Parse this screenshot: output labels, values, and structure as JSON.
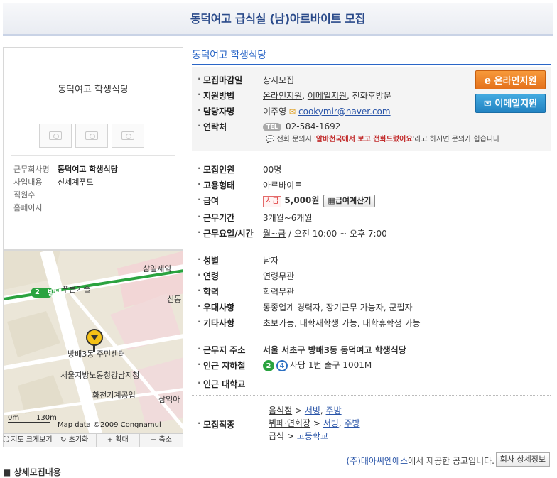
{
  "page": {
    "title": "동덕여고 급식실 (남)아르바이트 모집"
  },
  "company": {
    "name": "동덕여고 학생식당",
    "info": [
      {
        "key": "근무회사명",
        "value": "동덕여고 학생식당"
      },
      {
        "key": "사업내용",
        "value": "신세계푸드"
      },
      {
        "key": "직원수",
        "value": ""
      },
      {
        "key": "홈페이지",
        "value": ""
      }
    ]
  },
  "map": {
    "labels": {
      "samil": "삼일제약",
      "purun": "푸른기술",
      "bangbae": "방배",
      "sindong": "신동",
      "center": "방배3동 주민센터",
      "court": "서울지방노동청강남지청",
      "hwacheon": "화천기계공업",
      "samik": "삼익아",
      "scale_0": "0m",
      "scale_130": "130m",
      "copyright": "Map data ©2009 Congnamul",
      "station_num": "2"
    },
    "controls": [
      "지도 크게보기",
      "초기화",
      "확대",
      "축소"
    ]
  },
  "apply": {
    "rows": [
      {
        "key": "모집마감일",
        "value": "상시모집"
      },
      {
        "key": "지원방법",
        "online": "온라인지원",
        "email": "이메일지원",
        "phone": ", 전화후방문"
      },
      {
        "key": "담당자명",
        "name": "이주영",
        "email": "cookymir@naver.com"
      },
      {
        "key": "연락처",
        "tel_badge": "TEL",
        "phone": "02-584-1692"
      }
    ],
    "note_pre": "전화 문의시 '",
    "note_quote": "알바천국에서 보고 전화드렸어요",
    "note_post": "'라고 하시면 문의가 쉽습니다",
    "online_button": "온라인지원",
    "email_button": "이메일지원"
  },
  "conditions": {
    "rows": [
      {
        "key": "모집인원",
        "value": "00명"
      },
      {
        "key": "고용형태",
        "value": "아르바이트"
      },
      {
        "key": "급여",
        "badge": "시급",
        "value": "5,000원",
        "calc": "급여계산기"
      },
      {
        "key": "근무기간",
        "value": "3개월~6개월"
      },
      {
        "key": "근무요일/시간",
        "days": "월~금",
        "time": " / 오전 10:00 ~ 오후 7:00"
      }
    ]
  },
  "requirements": {
    "rows": [
      {
        "key": "성별",
        "value": "남자"
      },
      {
        "key": "연령",
        "value": "연령무관"
      },
      {
        "key": "학력",
        "value": "학력무관"
      },
      {
        "key": "우대사항",
        "value": "동종업계 경력자, 장기근무 가능자, 군필자"
      },
      {
        "key": "기타사항",
        "items": [
          "초보가능",
          "대학재학생 가능",
          "대학휴학생 가능"
        ]
      }
    ]
  },
  "location": {
    "rows": [
      {
        "key": "근무지 주소",
        "city": "서울",
        "gu": "서초구",
        "rest": "방배3동 동덕여고 학생식당"
      },
      {
        "key": "인근 지하철",
        "line2": "2",
        "line4": "4",
        "station": "사당",
        "exit": "1번 출구 1001M"
      },
      {
        "key": "인근 대학교",
        "value": ""
      }
    ]
  },
  "jobs": {
    "key": "모집직종",
    "lines": [
      {
        "a": "음식점",
        "b": "서빙",
        "c": "주방"
      },
      {
        "a": "뷔페·연회장",
        "b": "서빙",
        "c": "주방"
      },
      {
        "a": "급식",
        "b": "고등학교",
        "c": ""
      }
    ]
  },
  "footer": {
    "provider": "(주)대아씨엔에스",
    "text": "에서 제공한 공고입니다.",
    "detail_button": "회사 상세정보"
  },
  "bottom": {
    "cut_text": "상세모집내용"
  }
}
